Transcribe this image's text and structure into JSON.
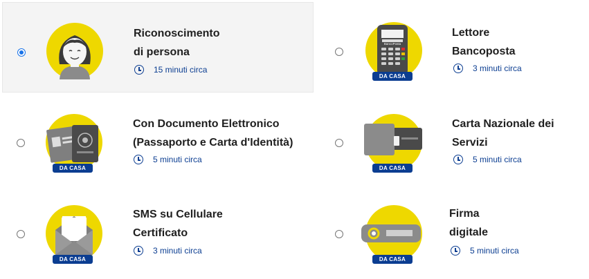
{
  "options": [
    {
      "title_line1": "Riconoscimento",
      "title_line2": "di persona",
      "duration": "15 minuti circa",
      "icon": "person-icon",
      "badge": ""
    },
    {
      "title_line1": "Lettore",
      "title_line2": "Bancoposta",
      "duration": "3 minuti circa",
      "icon": "card-reader-icon",
      "badge": "DA CASA"
    },
    {
      "title_line1": "Con Documento Elettronico",
      "title_line2": "(Passaporto e Carta d'Identità)",
      "duration": "5 minuti circa",
      "icon": "electronic-document-icon",
      "badge": "DA CASA"
    },
    {
      "title_line1": "Carta Nazionale dei",
      "title_line2": "Servizi",
      "duration": "5 minuti circa",
      "icon": "smart-card-icon",
      "badge": "DA CASA"
    },
    {
      "title_line1": "SMS su Cellulare",
      "title_line2": "Certificato",
      "duration": "3 minuti circa",
      "icon": "envelope-icon",
      "badge": "DA CASA"
    },
    {
      "title_line1": "Firma",
      "title_line2": "digitale",
      "duration": "5 minuti circa",
      "icon": "usb-token-icon",
      "badge": "DA CASA"
    }
  ],
  "card_reader_brand": "BancoPosta",
  "selected_index": 0,
  "colors": {
    "accent_yellow": "#eed800",
    "brand_blue": "#0b3d91",
    "radio_blue": "#1a73e8"
  }
}
